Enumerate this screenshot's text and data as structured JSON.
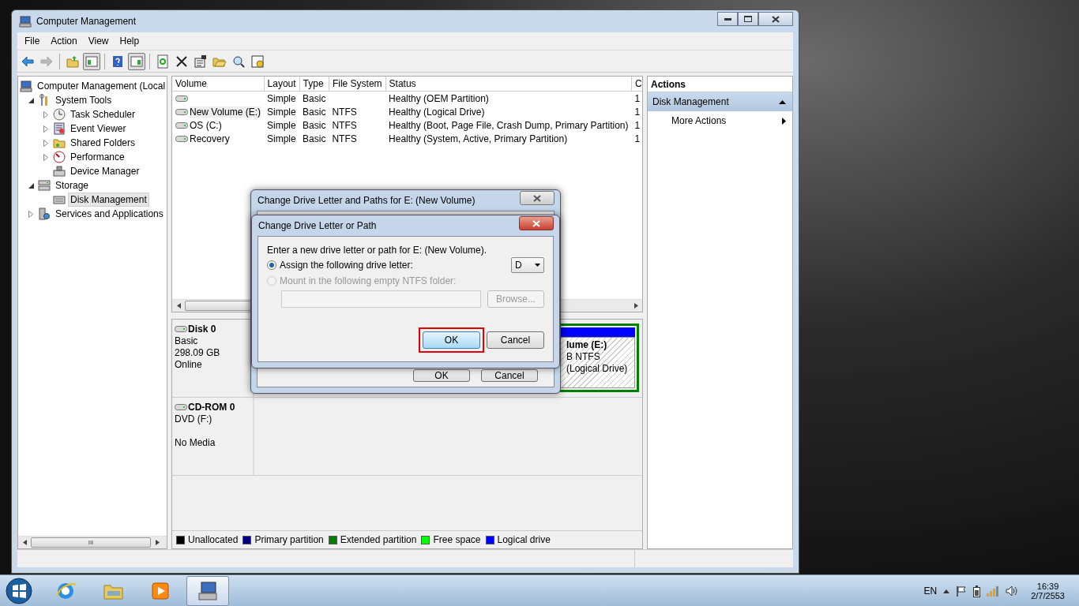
{
  "window": {
    "title": "Computer Management"
  },
  "menu": [
    "File",
    "Action",
    "View",
    "Help"
  ],
  "toolbar": {
    "buttons": [
      {
        "pressed": false,
        "disabled": false
      },
      {
        "pressed": false,
        "disabled": true
      },
      {
        "pressed": false,
        "disabled": false
      },
      {
        "pressed": true,
        "disabled": false
      },
      {
        "pressed": false,
        "disabled": false
      },
      {
        "pressed": true,
        "disabled": false
      },
      {
        "pressed": false,
        "disabled": false
      },
      {
        "pressed": false,
        "disabled": false
      },
      {
        "pressed": false,
        "disabled": false
      },
      {
        "pressed": false,
        "disabled": false
      },
      {
        "pressed": false,
        "disabled": false
      },
      {
        "pressed": false,
        "disabled": false
      }
    ]
  },
  "tree": {
    "items": [
      {
        "label": "Computer Management (Local",
        "kind": "root",
        "selected": false,
        "children": [
          {
            "label": "System Tools",
            "kind": "branch",
            "expanded": true,
            "selected": false,
            "children": [
              {
                "label": "Task Scheduler",
                "kind": "branch",
                "expanded": false,
                "selected": false
              },
              {
                "label": "Event Viewer",
                "kind": "branch",
                "expanded": false,
                "selected": false
              },
              {
                "label": "Shared Folders",
                "kind": "branch",
                "expanded": false,
                "selected": false
              },
              {
                "label": "Performance",
                "kind": "branch",
                "expanded": false,
                "selected": false
              },
              {
                "label": "Device Manager",
                "kind": "leaf",
                "selected": false
              }
            ]
          },
          {
            "label": "Storage",
            "kind": "branch",
            "expanded": true,
            "selected": false,
            "children": [
              {
                "label": "Disk Management",
                "kind": "leaf",
                "selected": true
              }
            ]
          },
          {
            "label": "Services and Applications",
            "kind": "branch",
            "expanded": false,
            "selected": false
          }
        ]
      }
    ],
    "scrollbar_grip": "III"
  },
  "table": {
    "columns": [
      "Volume",
      "Layout",
      "Type",
      "File System",
      "Status",
      "C"
    ],
    "rows": [
      {
        "selected": false,
        "cells": [
          "",
          "Simple",
          "Basic",
          "",
          "Healthy (OEM Partition)",
          "1"
        ]
      },
      {
        "selected": true,
        "cells": [
          "New Volume (E:)",
          "Simple",
          "Basic",
          "NTFS",
          "Healthy (Logical Drive)",
          "1"
        ]
      },
      {
        "selected": false,
        "cells": [
          "OS (C:)",
          "Simple",
          "Basic",
          "NTFS",
          "Healthy (Boot, Page File, Crash Dump, Primary Partition)",
          "1"
        ]
      },
      {
        "selected": false,
        "cells": [
          "Recovery",
          "Simple",
          "Basic",
          "NTFS",
          "Healthy (System, Active, Primary Partition)",
          "1"
        ]
      }
    ]
  },
  "disks": [
    {
      "kind": "disk",
      "name": "Disk 0",
      "lines": [
        "Basic",
        "298.09 GB"
      ],
      "status": "Online",
      "partitions": [
        {
          "lines": [
            "lume  (E:)",
            "B NTFS",
            "(Logical Drive)"
          ]
        }
      ]
    },
    {
      "kind": "cdrom",
      "name": "CD-ROM 0",
      "lines": [
        "DVD (F:)"
      ],
      "status": "No Media"
    }
  ],
  "legend": [
    {
      "label": "Unallocated",
      "color": "#000000"
    },
    {
      "label": "Primary partition",
      "color": "#000080"
    },
    {
      "label": "Extended partition",
      "color": "#008000"
    },
    {
      "label": "Free space",
      "color": "#00ff00"
    },
    {
      "label": "Logical drive",
      "color": "#0000ff"
    }
  ],
  "actions": {
    "title": "Actions",
    "group": {
      "label": "Disk Management",
      "expanded": true
    },
    "items": [
      "More Actions"
    ]
  },
  "back_dialog": {
    "title": "Change Drive Letter and Paths for E: (New Volume)",
    "buttons": [
      "OK",
      "Cancel"
    ]
  },
  "dialog": {
    "title": "Change Drive Letter or Path",
    "prompt": "Enter a new drive letter or path for E: (New Volume).",
    "options": [
      {
        "label": "Assign the following drive letter:",
        "selected": true,
        "disabled": false
      },
      {
        "label": "Mount in the following empty NTFS folder:",
        "selected": false,
        "disabled": true
      }
    ],
    "drive_letter": "D",
    "browse": {
      "label": "Browse...",
      "disabled": true
    },
    "buttons": [
      {
        "label": "OK",
        "default": true,
        "annotated": true
      },
      {
        "label": "Cancel",
        "default": false,
        "annotated": false
      }
    ]
  },
  "taskbar": {
    "items": [
      {
        "active": false
      },
      {
        "active": false
      },
      {
        "active": false
      },
      {
        "active": true
      }
    ],
    "language": "EN",
    "time": "16:39",
    "date": "2/7/2553"
  }
}
